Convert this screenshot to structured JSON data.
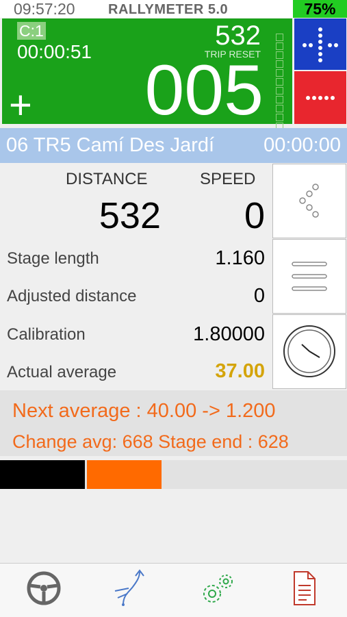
{
  "status_bar": {
    "time": "09:57:20",
    "app_name": "RALLYMETER 5.0",
    "battery": "75%"
  },
  "counter": {
    "checkpoint_badge": "C:1",
    "elapsed_time": "00:00:51",
    "trip_value": "532",
    "trip_reset_label": "TRIP RESET",
    "big_number": "005",
    "plus_symbol": "+"
  },
  "stage": {
    "name": "06 TR5 Camí Des Jardí",
    "time": "00:00:00"
  },
  "readings": {
    "distance_header": "DISTANCE",
    "speed_header": "SPEED",
    "distance_value": "532",
    "speed_value": "0",
    "rows": [
      {
        "label": "Stage length",
        "value": "1.160"
      },
      {
        "label": "Adjusted distance",
        "value": "0"
      },
      {
        "label": "Calibration",
        "value": "1.80000"
      },
      {
        "label": "Actual average",
        "value": "37.00"
      }
    ]
  },
  "next_info": {
    "line1": "Next average : 40.00   ->  1.200",
    "line2": "Change avg: 668  Stage end : 628"
  },
  "progress": {
    "segments": [
      {
        "color": "#000000",
        "fraction": 0.245
      },
      {
        "color": "#ff6a00",
        "fraction": 0.215
      }
    ]
  },
  "colors": {
    "counter_green": "#1aa21a",
    "plus_blue": "#1a3fc4",
    "minus_red": "#e8262e",
    "accent_orange": "#f26a1b",
    "average_gold": "#d4a40a"
  },
  "tabs": [
    {
      "icon": "steering-wheel-icon"
    },
    {
      "icon": "route-icon"
    },
    {
      "icon": "settings-gears-icon"
    },
    {
      "icon": "document-icon"
    }
  ]
}
